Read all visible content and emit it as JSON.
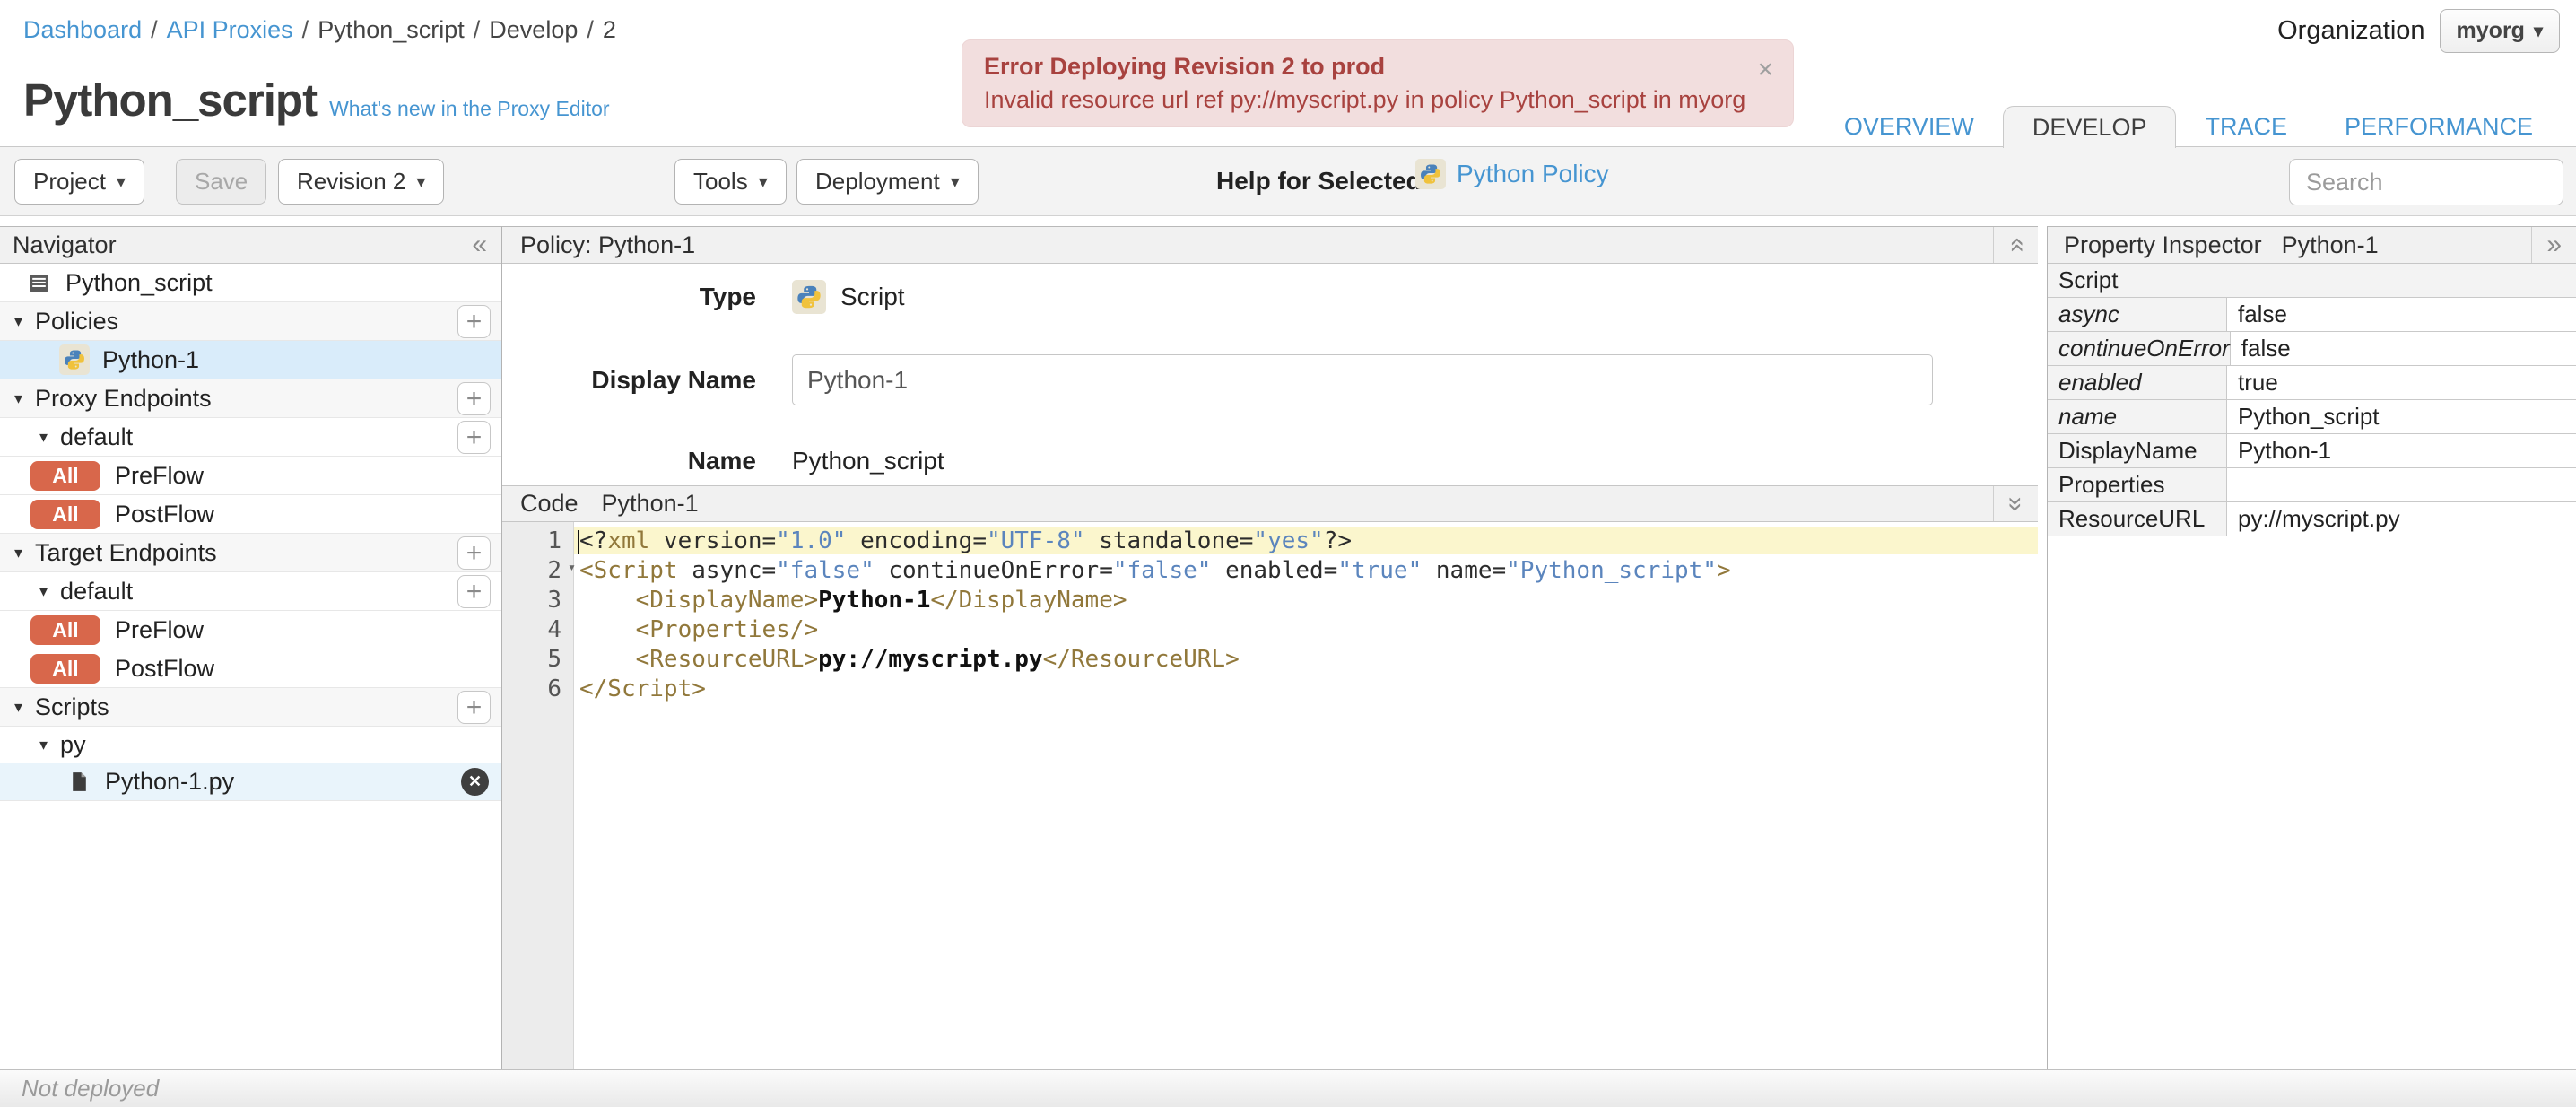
{
  "icons": {
    "caret": "▾",
    "collapse_left": "«",
    "expand_right": "»",
    "chevrons": "»",
    "close": "×",
    "plus": "+",
    "triangle": "▾",
    "delete": "✕",
    "fold": "▾"
  },
  "breadcrumb": {
    "separator": "/",
    "items": [
      {
        "label": "Dashboard"
      },
      {
        "label": "API Proxies"
      },
      {
        "label": "Python_script"
      },
      {
        "label": "Develop"
      },
      {
        "label": "2"
      }
    ]
  },
  "organization": {
    "label": "Organization",
    "value": "myorg"
  },
  "error_banner": {
    "title": "Error Deploying Revision 2 to prod",
    "message": "Invalid resource url ref py://myscript.py in policy Python_script in myorg"
  },
  "proxy": {
    "title": "Python_script",
    "whats_new": "What's new in the Proxy Editor"
  },
  "tabs": {
    "items": [
      {
        "label": "OVERVIEW"
      },
      {
        "label": "DEVELOP"
      },
      {
        "label": "TRACE"
      },
      {
        "label": "PERFORMANCE"
      }
    ]
  },
  "toolbar": {
    "project": "Project",
    "save": "Save",
    "revision": "Revision 2",
    "tools": "Tools",
    "deployment": "Deployment",
    "help_for_selected": "Help for Selected",
    "policy_link": "Python Policy",
    "search_placeholder": "Search"
  },
  "navigator": {
    "title": "Navigator",
    "root": "Python_script",
    "policies": {
      "label": "Policies",
      "item": "Python-1"
    },
    "proxy_endpoints": {
      "label": "Proxy Endpoints",
      "endpoint": "default",
      "flows": [
        {
          "badge": "All",
          "label": "PreFlow"
        },
        {
          "badge": "All",
          "label": "PostFlow"
        }
      ]
    },
    "target_endpoints": {
      "label": "Target Endpoints",
      "endpoint": "default",
      "flows": [
        {
          "badge": "All",
          "label": "PreFlow"
        },
        {
          "badge": "All",
          "label": "PostFlow"
        }
      ]
    },
    "scripts": {
      "label": "Scripts",
      "folder": "py",
      "file": "Python-1.py"
    }
  },
  "policy_panel": {
    "header": "Policy: Python-1",
    "type_label": "Type",
    "type_value": "Script",
    "display_name_label": "Display Name",
    "display_name_value": "Python-1",
    "name_label": "Name",
    "name_value": "Python_script"
  },
  "code_panel": {
    "label": "Code",
    "name": "Python-1",
    "lines": [
      {
        "num": "1",
        "highlight": true,
        "cursor": true,
        "tokens": [
          {
            "c": "pi",
            "t": "<?"
          },
          {
            "c": "tag",
            "t": "xml"
          },
          {
            "c": "attr",
            "t": " version="
          },
          {
            "c": "val",
            "t": "\"1.0\""
          },
          {
            "c": "attr",
            "t": " encoding="
          },
          {
            "c": "val",
            "t": "\"UTF-8\""
          },
          {
            "c": "attr",
            "t": " standalone="
          },
          {
            "c": "val",
            "t": "\"yes\""
          },
          {
            "c": "pi",
            "t": "?>"
          }
        ]
      },
      {
        "num": "2",
        "fold": true,
        "tokens": [
          {
            "c": "tag",
            "t": "<Script"
          },
          {
            "c": "attr",
            "t": " async="
          },
          {
            "c": "val",
            "t": "\"false\""
          },
          {
            "c": "attr",
            "t": " continueOnError="
          },
          {
            "c": "val",
            "t": "\"false\""
          },
          {
            "c": "attr",
            "t": " enabled="
          },
          {
            "c": "val",
            "t": "\"true\""
          },
          {
            "c": "attr",
            "t": " name="
          },
          {
            "c": "val",
            "t": "\"Python_script\""
          },
          {
            "c": "tag",
            "t": ">"
          }
        ]
      },
      {
        "num": "3",
        "tokens": [
          {
            "c": "attr",
            "t": "    "
          },
          {
            "c": "tag",
            "t": "<DisplayName>"
          },
          {
            "c": "text",
            "t": "Python-1"
          },
          {
            "c": "tag",
            "t": "</DisplayName>"
          }
        ]
      },
      {
        "num": "4",
        "tokens": [
          {
            "c": "attr",
            "t": "    "
          },
          {
            "c": "tag",
            "t": "<Properties/>"
          }
        ]
      },
      {
        "num": "5",
        "tokens": [
          {
            "c": "attr",
            "t": "    "
          },
          {
            "c": "tag",
            "t": "<ResourceURL>"
          },
          {
            "c": "text",
            "t": "py://myscript.py"
          },
          {
            "c": "tag",
            "t": "</ResourceURL>"
          }
        ]
      },
      {
        "num": "6",
        "tokens": [
          {
            "c": "tag",
            "t": "</Script>"
          }
        ]
      }
    ]
  },
  "property_inspector": {
    "title": "Property Inspector",
    "subtitle": "Python-1",
    "section": "Script",
    "rows": [
      {
        "key": "async",
        "value": "false"
      },
      {
        "key": "continueOnError",
        "value": "false"
      },
      {
        "key": "enabled",
        "value": "true"
      },
      {
        "key": "name",
        "value": "Python_script"
      },
      {
        "key": "DisplayName",
        "value": "Python-1"
      },
      {
        "key": "Properties",
        "value": ""
      },
      {
        "key": "ResourceURL",
        "value": "py://myscript.py"
      }
    ]
  },
  "status_bar": {
    "text": "Not deployed"
  }
}
